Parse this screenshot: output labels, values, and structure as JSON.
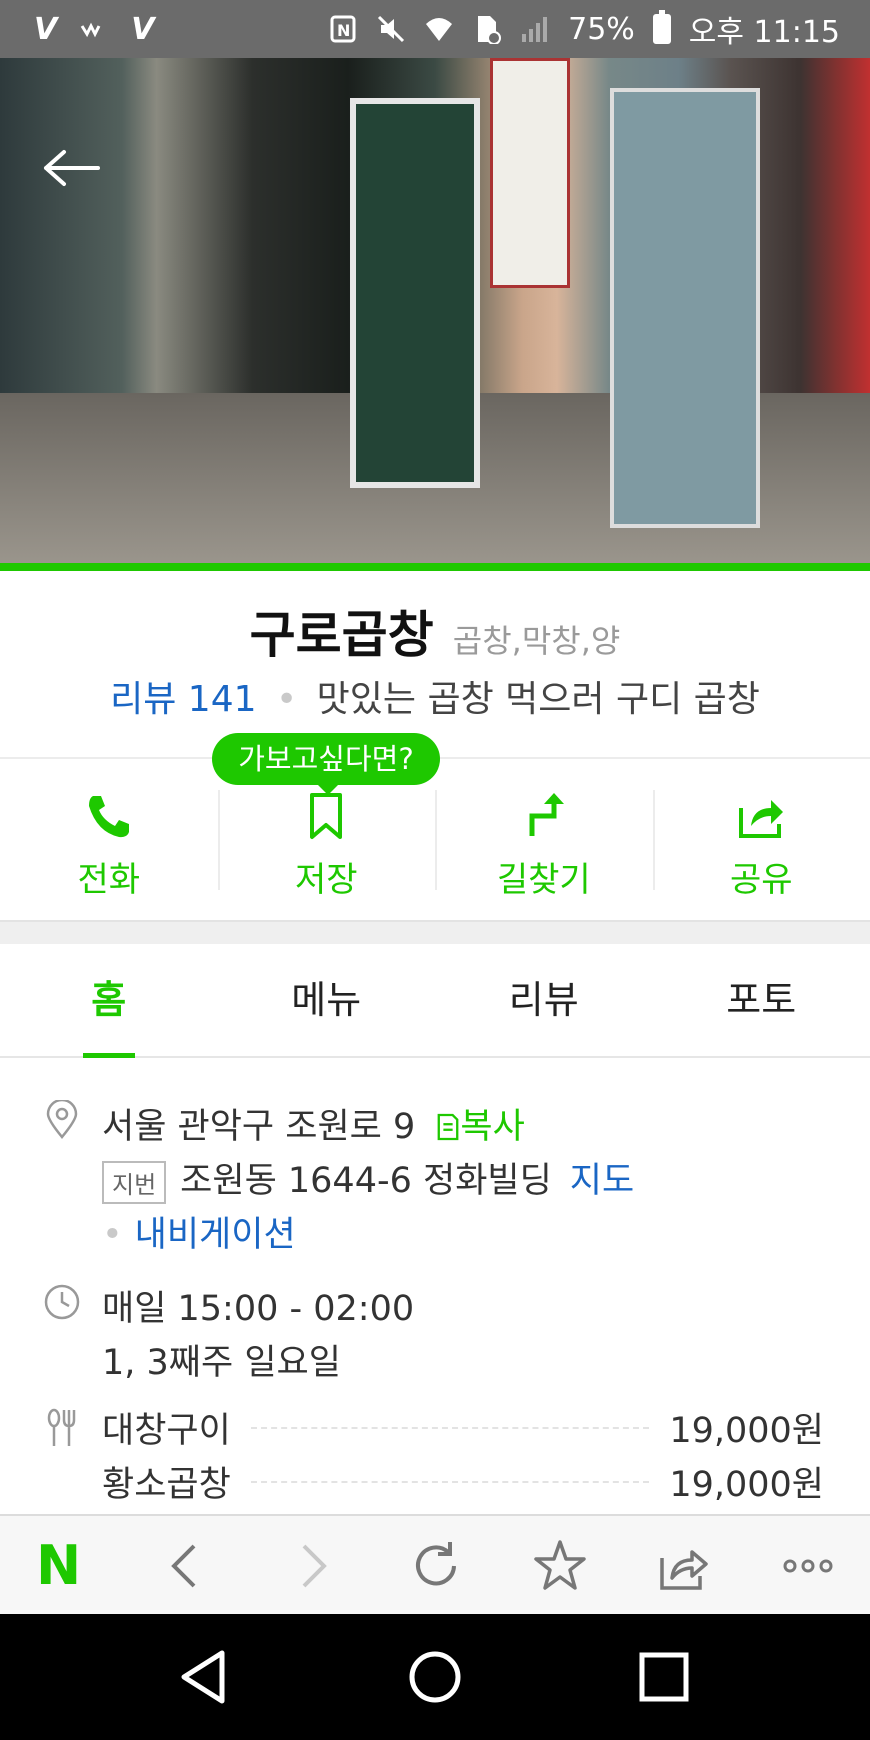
{
  "status_bar": {
    "battery": "75%",
    "time": "오후 11:15",
    "left_icons": [
      "v-icon",
      "wifi-calling-icon",
      "volte-icon"
    ],
    "right_icons": [
      "nfc-icon",
      "mute-icon",
      "wifi-icon",
      "file-error-icon",
      "signal-icon",
      "battery-icon"
    ]
  },
  "place": {
    "name": "구로곱창",
    "category": "곱창,막창,양",
    "review_label": "리뷰 141",
    "description": "맛있는 곱창 먹으러 구디 곱창"
  },
  "tooltip": "가보고싶다면?",
  "actions": [
    {
      "label": "전화",
      "icon": "phone-icon"
    },
    {
      "label": "저장",
      "icon": "bookmark-icon"
    },
    {
      "label": "길찾기",
      "icon": "directions-icon"
    },
    {
      "label": "공유",
      "icon": "share-icon"
    }
  ],
  "tabs": [
    {
      "label": "홈",
      "active": true
    },
    {
      "label": "메뉴",
      "active": false
    },
    {
      "label": "리뷰",
      "active": false
    },
    {
      "label": "포토",
      "active": false
    }
  ],
  "address": {
    "road": "서울 관악구 조원로 9",
    "copy": "복사",
    "jibeon_tag": "지번",
    "jibeon": "조원동 1644-6 정화빌딩",
    "map": "지도",
    "navigation": "내비게이션"
  },
  "hours": {
    "daily": "매일 15:00 - 02:00",
    "closed": "1, 3째주 일요일"
  },
  "menu": [
    {
      "name": "대창구이",
      "price": "19,000원"
    },
    {
      "name": "황소곱창",
      "price": "19,000원"
    }
  ],
  "colors": {
    "accent": "#1ec800",
    "link": "#1a66c4"
  }
}
